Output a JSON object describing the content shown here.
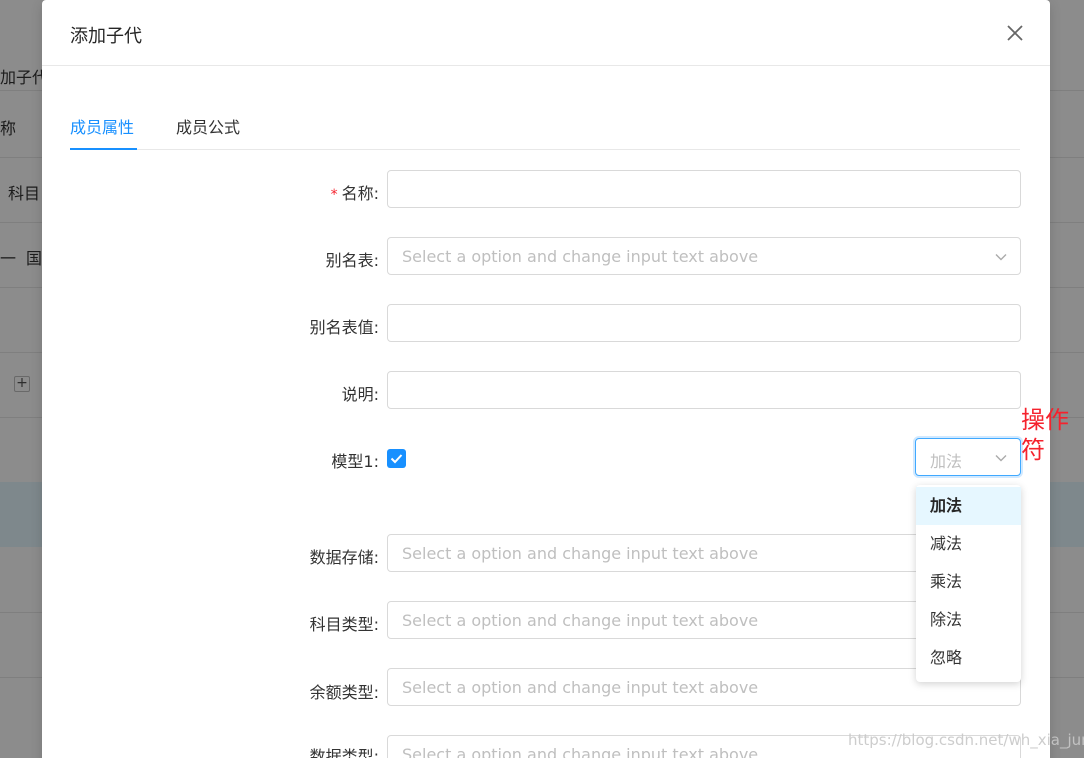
{
  "background": {
    "texts": [
      "加子代",
      "称",
      "科目",
      "一",
      "国"
    ]
  },
  "modal": {
    "title": "添加子代",
    "close_icon": "close-icon"
  },
  "tabs": [
    {
      "label": "成员属性",
      "active": true
    },
    {
      "label": "成员公式",
      "active": false
    }
  ],
  "form": {
    "name_label": "名称:",
    "required_mark": "*",
    "alias_table_label": "别名表:",
    "alias_table_placeholder": "Select a option and change input text above",
    "alias_value_label": "别名表值:",
    "description_label": "说明:",
    "model_label": "模型1:",
    "model_checked": true,
    "operator_placeholder": "加法",
    "data_storage_label": "数据存储:",
    "data_storage_placeholder": "Select a option and change input text above",
    "subject_type_label": "科目类型:",
    "subject_type_placeholder": "Select a option and change input text above",
    "balance_type_label": "余额类型:",
    "balance_type_placeholder": "Select a option and change input text above",
    "data_type_label": "数据类型:",
    "data_type_placeholder": "Select a option and change input text above"
  },
  "operator_dropdown": {
    "options": [
      "加法",
      "减法",
      "乘法",
      "除法",
      "忽略"
    ],
    "selected": "加法"
  },
  "annotation": {
    "line1": "操作",
    "line2": "符"
  },
  "watermark": "https://blog.csdn.net/wh_xia_jun",
  "colors": {
    "primary": "#1890ff",
    "annotation": "#f5222d"
  }
}
